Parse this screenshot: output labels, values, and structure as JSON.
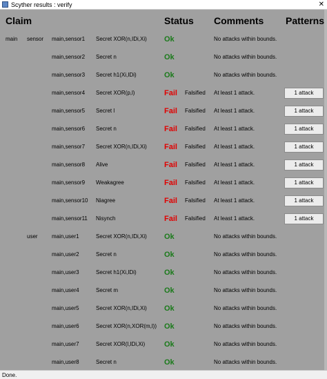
{
  "window": {
    "title": "Scyther results : verify",
    "close_glyph": "✕"
  },
  "headers": {
    "claim": "Claim",
    "status": "Status",
    "comments": "Comments",
    "patterns": "Patterns"
  },
  "colors": {
    "ok": "#1a7a1a",
    "fail": "#e00000",
    "background": "#a0a0a0"
  },
  "rows": [
    {
      "protocol": "main",
      "role": "sensor",
      "id": "main,sensor1",
      "claim": "Secret XOR(n,IDi,Xi)",
      "status": "Ok",
      "falsified": "",
      "comment": "No attacks within bounds.",
      "pattern": ""
    },
    {
      "protocol": "",
      "role": "",
      "id": "main,sensor2",
      "claim": "Secret n",
      "status": "Ok",
      "falsified": "",
      "comment": "No attacks within bounds.",
      "pattern": ""
    },
    {
      "protocol": "",
      "role": "",
      "id": "main,sensor3",
      "claim": "Secret h1(Xi,IDi)",
      "status": "Ok",
      "falsified": "",
      "comment": "No attacks within bounds.",
      "pattern": ""
    },
    {
      "protocol": "",
      "role": "",
      "id": "main,sensor4",
      "claim": "Secret XOR(p,l)",
      "status": "Fail",
      "falsified": "Falsified",
      "comment": "At least 1 attack.",
      "pattern": "1 attack"
    },
    {
      "protocol": "",
      "role": "",
      "id": "main,sensor5",
      "claim": "Secret l",
      "status": "Fail",
      "falsified": "Falsified",
      "comment": "At least 1 attack.",
      "pattern": "1 attack"
    },
    {
      "protocol": "",
      "role": "",
      "id": "main,sensor6",
      "claim": "Secret n",
      "status": "Fail",
      "falsified": "Falsified",
      "comment": "At least 1 attack.",
      "pattern": "1 attack"
    },
    {
      "protocol": "",
      "role": "",
      "id": "main,sensor7",
      "claim": "Secret XOR(n,IDi,Xi)",
      "status": "Fail",
      "falsified": "Falsified",
      "comment": "At least 1 attack.",
      "pattern": "1 attack"
    },
    {
      "protocol": "",
      "role": "",
      "id": "main,sensor8",
      "claim": "Alive",
      "status": "Fail",
      "falsified": "Falsified",
      "comment": "At least 1 attack.",
      "pattern": "1 attack"
    },
    {
      "protocol": "",
      "role": "",
      "id": "main,sensor9",
      "claim": "Weakagree",
      "status": "Fail",
      "falsified": "Falsified",
      "comment": "At least 1 attack.",
      "pattern": "1 attack"
    },
    {
      "protocol": "",
      "role": "",
      "id": "main,sensor10",
      "claim": "Niagree",
      "status": "Fail",
      "falsified": "Falsified",
      "comment": "At least 1 attack.",
      "pattern": "1 attack"
    },
    {
      "protocol": "",
      "role": "",
      "id": "main,sensor11",
      "claim": "Nisynch",
      "status": "Fail",
      "falsified": "Falsified",
      "comment": "At least 1 attack.",
      "pattern": "1 attack"
    },
    {
      "protocol": "",
      "role": "user",
      "id": "main,user1",
      "claim": "Secret XOR(n,IDi,Xi)",
      "status": "Ok",
      "falsified": "",
      "comment": "No attacks within bounds.",
      "pattern": ""
    },
    {
      "protocol": "",
      "role": "",
      "id": "main,user2",
      "claim": "Secret n",
      "status": "Ok",
      "falsified": "",
      "comment": "No attacks within bounds.",
      "pattern": ""
    },
    {
      "protocol": "",
      "role": "",
      "id": "main,user3",
      "claim": "Secret h1(Xi,IDi)",
      "status": "Ok",
      "falsified": "",
      "comment": "No attacks within bounds.",
      "pattern": ""
    },
    {
      "protocol": "",
      "role": "",
      "id": "main,user4",
      "claim": "Secret m",
      "status": "Ok",
      "falsified": "",
      "comment": "No attacks within bounds.",
      "pattern": ""
    },
    {
      "protocol": "",
      "role": "",
      "id": "main,user5",
      "claim": "Secret XOR(n,IDi,Xi)",
      "status": "Ok",
      "falsified": "",
      "comment": "No attacks within bounds.",
      "pattern": ""
    },
    {
      "protocol": "",
      "role": "",
      "id": "main,user6",
      "claim": "Secret XOR(n,XOR(m,l))",
      "status": "Ok",
      "falsified": "",
      "comment": "No attacks within bounds.",
      "pattern": ""
    },
    {
      "protocol": "",
      "role": "",
      "id": "main,user7",
      "claim": "Secret XOR(l,IDi,Xi)",
      "status": "Ok",
      "falsified": "",
      "comment": "No attacks within bounds.",
      "pattern": ""
    },
    {
      "protocol": "",
      "role": "",
      "id": "main,user8",
      "claim": "Secret n",
      "status": "Ok",
      "falsified": "",
      "comment": "No attacks within bounds.",
      "pattern": ""
    }
  ],
  "statusbar": {
    "text": "Done."
  }
}
